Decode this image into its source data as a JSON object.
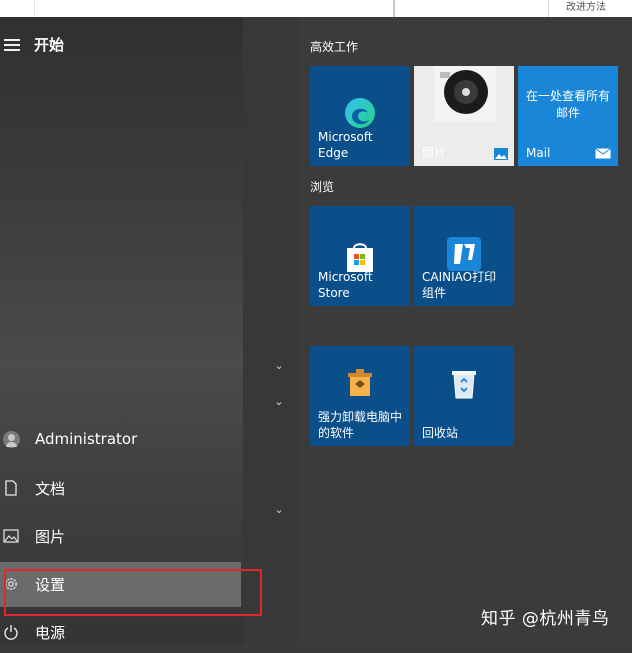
{
  "top_strip": {
    "fragment_text": "改进方法"
  },
  "start": {
    "title": "开始",
    "user": {
      "name": "Administrator"
    },
    "nav": [
      {
        "id": "documents",
        "label": "文档",
        "icon": "document-icon"
      },
      {
        "id": "pictures",
        "label": "图片",
        "icon": "picture-icon"
      },
      {
        "id": "settings",
        "label": "设置",
        "icon": "gear-icon"
      },
      {
        "id": "power",
        "label": "电源",
        "icon": "power-icon"
      }
    ],
    "groups": [
      {
        "title": "高效工作",
        "tiles": [
          {
            "label": "Microsoft Edge",
            "icon": "edge-icon",
            "color": "#0a4f8a"
          },
          {
            "label": "照片",
            "icon": "photos-icon",
            "color": "#e8e8e8"
          },
          {
            "label": "Mail",
            "top_text": "在一处查看所有邮件",
            "icon": "mail-icon",
            "color": "#1a86d8"
          }
        ]
      },
      {
        "title": "浏览",
        "tiles": [
          {
            "label": "Microsoft Store",
            "icon": "store-icon",
            "color": "#0a4f8a"
          },
          {
            "label": "CAINIAO打印组件",
            "icon": "cainiao-icon",
            "color": "#0a4f8a"
          }
        ]
      },
      {
        "title": "",
        "tiles": [
          {
            "label": "强力卸载电脑中的软件",
            "icon": "uninstall-icon",
            "color": "#0a4f8a"
          },
          {
            "label": "回收站",
            "icon": "recycle-bin-icon",
            "color": "#0a4f8a"
          }
        ]
      }
    ]
  },
  "watermark": "知乎 @杭州青鸟",
  "colors": {
    "accent_tile": "#0a4f8a",
    "mail_tile": "#1a86d8",
    "highlight_box": "#e0272f"
  }
}
